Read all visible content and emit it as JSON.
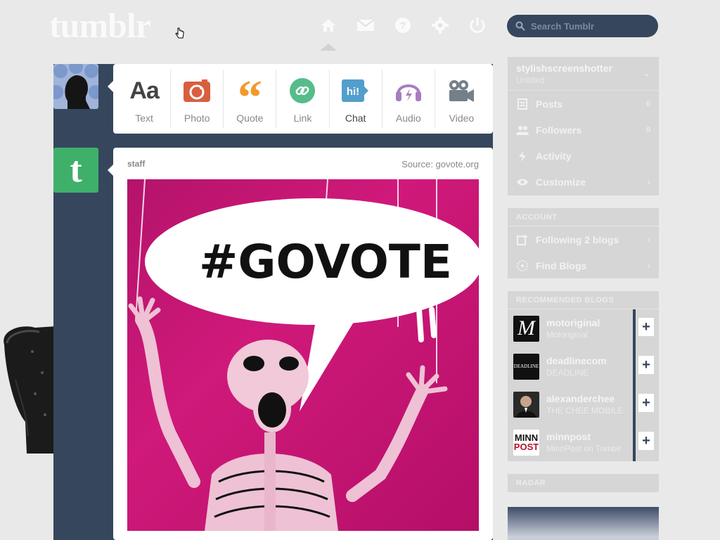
{
  "header": {
    "logo": "tumblr",
    "search_placeholder": "Search Tumblr",
    "nav": [
      "home-icon",
      "mail-icon",
      "help-icon",
      "gear-icon",
      "power-icon"
    ]
  },
  "post_types": [
    {
      "label": "Text",
      "icon": "text-icon",
      "color": "#444444"
    },
    {
      "label": "Photo",
      "icon": "camera-icon",
      "color": "#d95e40"
    },
    {
      "label": "Quote",
      "icon": "quote-icon",
      "color": "#f2992e"
    },
    {
      "label": "Link",
      "icon": "link-icon",
      "color": "#56bc8a"
    },
    {
      "label": "Chat",
      "icon": "chat-icon",
      "color": "#529ecc"
    },
    {
      "label": "Audio",
      "icon": "headphones-icon",
      "color": "#a77dc2"
    },
    {
      "label": "Video",
      "icon": "video-camera-icon",
      "color": "#748089"
    }
  ],
  "post": {
    "author": "staff",
    "source": "Source: govote.org",
    "image_text": "#GOVOTE"
  },
  "sidebar": {
    "blog_name": "stylishscreenshotter",
    "blog_subtitle": "Untitled",
    "items": [
      {
        "label": "Posts",
        "count": "0",
        "icon": "posts-icon"
      },
      {
        "label": "Followers",
        "count": "0",
        "icon": "followers-icon"
      },
      {
        "label": "Activity",
        "count": "",
        "icon": "activity-icon"
      },
      {
        "label": "Customize",
        "count": "›",
        "icon": "eye-icon"
      }
    ],
    "account_header": "ACCOUNT",
    "account_items": [
      {
        "label": "Following 2 blogs",
        "icon": "following-icon"
      },
      {
        "label": "Find Blogs",
        "icon": "find-icon"
      }
    ],
    "recommended_header": "RECOMMENDED BLOGS",
    "recommended": [
      {
        "name": "motoriginal",
        "subtitle": "Motoriginal",
        "thumb": "M"
      },
      {
        "name": "deadlinecom",
        "subtitle": "DEADLINE",
        "thumb": "DEADLINE"
      },
      {
        "name": "alexanderchee",
        "subtitle": "THE CHEE MOBILE",
        "thumb": ""
      },
      {
        "name": "minnpost",
        "subtitle": "MinnPost on Tumblr",
        "thumb": "MINN POST"
      }
    ],
    "radar_header": "RADAR"
  }
}
